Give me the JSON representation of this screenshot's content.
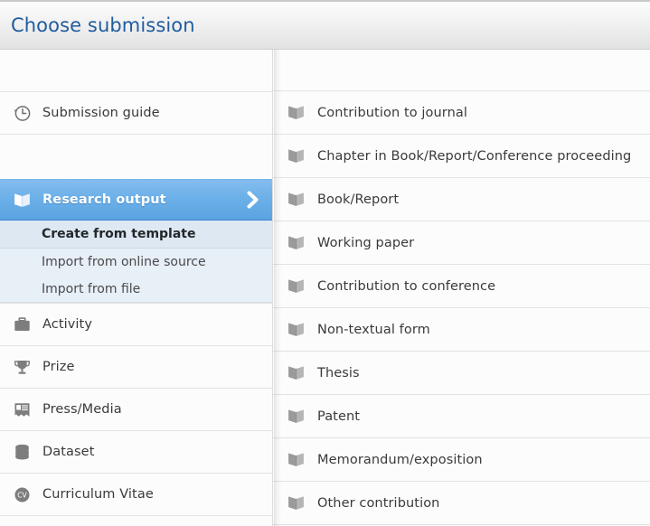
{
  "header": {
    "title": "Choose submission"
  },
  "colors": {
    "title_blue": "#1f5c9e",
    "highlight_blue": "#6cb0e8",
    "sub_item_bg": "#e7eff7",
    "selected_sub_item_bg": "#dde8f2",
    "icon_gray": "#8d8d8d",
    "text_gray": "#3a3a3a",
    "divider": "#e3e3e3"
  },
  "sidebar": {
    "guide": {
      "label": "Submission guide",
      "icon": "clock-history-icon"
    },
    "active_group": {
      "label": "Research output",
      "icon": "open-book-icon",
      "chevron": "chevron-right-icon",
      "sub_items": [
        {
          "label": "Create from template",
          "selected": true
        },
        {
          "label": "Import from online source",
          "selected": false
        },
        {
          "label": "Import from file",
          "selected": false
        }
      ]
    },
    "items": [
      {
        "label": "Activity",
        "icon": "briefcase-icon"
      },
      {
        "label": "Prize",
        "icon": "trophy-icon"
      },
      {
        "label": "Press/Media",
        "icon": "press-media-icon"
      },
      {
        "label": "Dataset",
        "icon": "dataset-icon"
      },
      {
        "label": "Curriculum Vitae",
        "icon": "cv-badge-icon"
      }
    ]
  },
  "submission_types": [
    {
      "label": "Contribution to journal",
      "icon": "open-book-icon"
    },
    {
      "label": "Chapter in Book/Report/Conference proceeding",
      "icon": "open-book-icon"
    },
    {
      "label": "Book/Report",
      "icon": "open-book-icon"
    },
    {
      "label": "Working paper",
      "icon": "open-book-icon"
    },
    {
      "label": "Contribution to conference",
      "icon": "open-book-icon"
    },
    {
      "label": "Non-textual form",
      "icon": "open-book-icon"
    },
    {
      "label": "Thesis",
      "icon": "open-book-icon"
    },
    {
      "label": "Patent",
      "icon": "open-book-icon"
    },
    {
      "label": "Memorandum/exposition",
      "icon": "open-book-icon"
    },
    {
      "label": "Other contribution",
      "icon": "open-book-icon"
    }
  ]
}
